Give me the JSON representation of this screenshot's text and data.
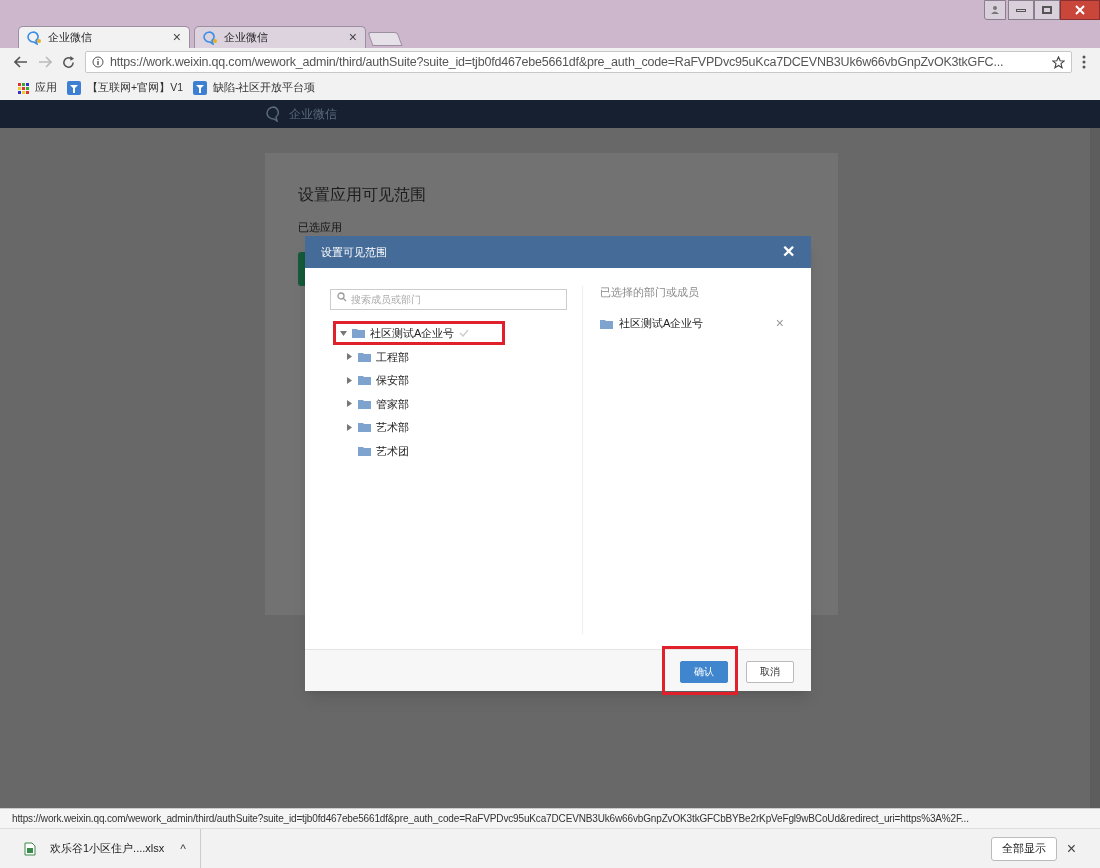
{
  "browser": {
    "tabs": [
      {
        "title": "企业微信",
        "selected": true,
        "close": "×"
      },
      {
        "title": "企业微信",
        "selected": false,
        "close": "×"
      }
    ],
    "address": "https://work.weixin.qq.com/wework_admin/third/authSuite?suite_id=tjb0fd467ebe5661df&pre_auth_code=RaFVPDvc95uKca7DCEVNB3Uk6w66vbGnpZvOK3tkGFC...",
    "bookmarks": [
      {
        "label": "应用",
        "kind": "apps"
      },
      {
        "label": "【互联网+官网】V1",
        "kind": "site"
      },
      {
        "label": "缺陷-社区开放平台项",
        "kind": "site"
      }
    ]
  },
  "header": {
    "logo_text": "企业微信"
  },
  "page": {
    "title": "设置应用可见范围",
    "section_label": "已选应用"
  },
  "dialog": {
    "title": "设置可见范围",
    "close": "✕",
    "search": {
      "placeholder": "搜索成员或部门"
    },
    "tree": [
      {
        "label": "社区测试A企业号",
        "expanded": true,
        "checked": true,
        "highlighted": true,
        "children": [
          {
            "label": "工程部",
            "has_children": true
          },
          {
            "label": "保安部",
            "has_children": true
          },
          {
            "label": "管家部",
            "has_children": true
          },
          {
            "label": "艺术部",
            "has_children": true
          },
          {
            "label": "艺术团",
            "has_children": false
          }
        ]
      }
    ],
    "selected_heading": "已选择的部门或成员",
    "selected": [
      {
        "label": "社区测试A企业号",
        "remove": "×"
      }
    ],
    "buttons": [
      {
        "label": "确认",
        "kind": "primary",
        "highlighted": true
      },
      {
        "label": "取消",
        "kind": "secondary",
        "highlighted": false
      }
    ]
  },
  "status_url": "https://work.weixin.qq.com/wework_admin/third/authSuite?suite_id=tjb0fd467ebe5661df&pre_auth_code=RaFVPDvc95uKca7DCEVNB3Uk6w66vbGnpZvOK3tkGFCbBYBe2rKpVeFgl9wBCoUd&redirect_uri=https%3A%2F...",
  "downloads": {
    "items": [
      {
        "name": "欢乐谷1小区住户....xlsx",
        "caret": "^"
      }
    ],
    "show_all": "全部显示",
    "close": "×"
  }
}
